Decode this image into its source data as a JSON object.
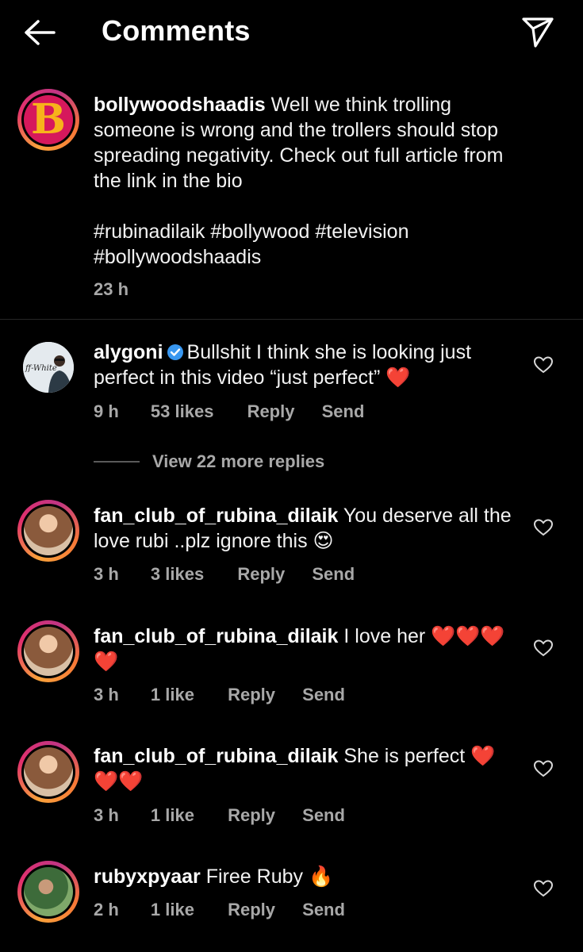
{
  "header": {
    "title": "Comments"
  },
  "caption": {
    "username": "bollywoodshaadis",
    "avatar_letter": "B",
    "text": "Well we think trolling someone is wrong and the trollers should stop spreading negativity. Check out full article from the link in the bio",
    "hashtags": "#rubinadilaik #bollywood #television #bollywoodshaadis",
    "time": "23 h"
  },
  "comments": [
    {
      "username": "alygoni",
      "verified": true,
      "text": "Bullshit I think she is looking just perfect in this video “just perfect” ❤️",
      "time": "9 h",
      "likes": "53 likes",
      "reply": "Reply",
      "send": "Send",
      "avatar_badge": "ff-White"
    },
    {
      "username": "fan_club_of_rubina_dilaik",
      "text": "You deserve all the love rubi ..plz ignore this 😍",
      "time": "3 h",
      "likes": "3 likes",
      "reply": "Reply",
      "send": "Send"
    },
    {
      "username": "fan_club_of_rubina_dilaik",
      "text": "I love her ❤️❤️❤️ ❤️",
      "time": "3 h",
      "likes": "1 like",
      "reply": "Reply",
      "send": "Send"
    },
    {
      "username": "fan_club_of_rubina_dilaik",
      "text": "She is perfect ❤️ ❤️❤️",
      "time": "3 h",
      "likes": "1 like",
      "reply": "Reply",
      "send": "Send"
    },
    {
      "username": "rubyxpyaar",
      "text": "Firee Ruby 🔥",
      "time": "2 h",
      "likes": "1 like",
      "reply": "Reply",
      "send": "Send"
    }
  ],
  "view_replies": "View 22 more replies",
  "colors": {
    "background": "#000000",
    "secondary_text": "#a8a8a8",
    "heart_red": "#e0243b",
    "verified_blue": "#3897f0"
  }
}
